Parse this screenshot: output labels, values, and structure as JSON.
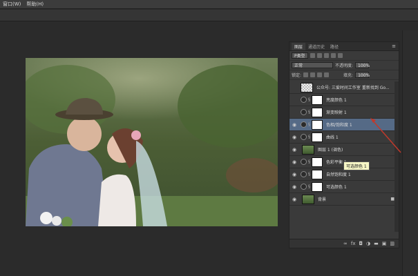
{
  "menubar": {
    "items": [
      "窗口(W)",
      "帮助(H)"
    ]
  },
  "panel": {
    "tabs": [
      "图层",
      "通道历史",
      "路径"
    ],
    "filter_label": "P类型",
    "blend_mode": "正常",
    "opacity_label": "不透明度:",
    "opacity_value": "100%",
    "lock_label": "锁定:",
    "fill_label": "填充:",
    "fill_value": "100%"
  },
  "layers": [
    {
      "name": "公众号: 三爱时间工作室  重新找到 Go...",
      "visible": false,
      "thumb": "checker"
    },
    {
      "name": "亮度颜色 1",
      "visible": false,
      "thumb": "mask"
    },
    {
      "name": "渐变映射 1",
      "visible": false,
      "thumb": "mask"
    },
    {
      "name": "色相/饱和度 1",
      "visible": true,
      "thumb": "mask",
      "selected": true
    },
    {
      "name": "曲线 1",
      "visible": true,
      "thumb": "mask"
    },
    {
      "name": "图层 1 (调色)",
      "visible": true,
      "thumb": "image"
    },
    {
      "name": "色彩平衡 1",
      "visible": true,
      "thumb": "mask"
    },
    {
      "name": "自然饱和度 1",
      "visible": true,
      "thumb": "mask"
    },
    {
      "name": "可选颜色 1",
      "visible": true,
      "thumb": "mask"
    },
    {
      "name": "背景",
      "visible": true,
      "thumb": "image",
      "locked": true
    }
  ],
  "tooltip": "可选颜色 1",
  "accent": "#556a86"
}
